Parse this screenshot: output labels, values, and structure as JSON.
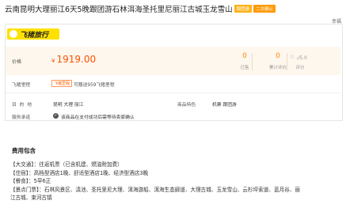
{
  "header": {
    "title": "云南昆明大理丽江6天5晚跟团游石林洱海圣托里尼丽江古城玉龙雪山",
    "badges": [
      "跟团游",
      "二次确认"
    ],
    "seller_nick": "幸福"
  },
  "brand": {
    "logo_text": "飞猪旅行",
    "logo_color": "#ffe100"
  },
  "price": {
    "label": "价格",
    "currency": "¥",
    "value": "1919.00",
    "sold_count": "0",
    "sold_label": "已售",
    "review_count": "0",
    "review_label": "累计评价",
    "rating": "-/5.0",
    "rating_label": "评分"
  },
  "mileage": {
    "label": "飞猪里程",
    "tag": "飞猪里程",
    "text": "可赠送959飞猪里程"
  },
  "info": {
    "destination_label": "目 的 地",
    "destination_value": "昆明  大理  丽江",
    "feature_label": "商品特色",
    "feature_value": "机票  跟团游",
    "service_label": "服务承诺",
    "service_value": "该商品在支付成功后需等待卖家确认"
  },
  "fees": {
    "title": "费用包含",
    "lines": [
      "【大交通】：往返机票（已含机建、燃油附加费）",
      "【住宿】：高档型酒店1晚、舒适型酒店1晚、经济型酒店3晚",
      "【餐食】：5早6正",
      "【景点门票】：石林风景区、滇池、圣托里尼大理、洱海游船、洱海生态廊道、大理古城、玉龙雪山、云杉坪索道、蓝月谷、丽",
      "江古城、束河古镇"
    ]
  },
  "colors": {
    "accent": "#ff5000",
    "stat": "#ff8a00",
    "band": "#fdf7ee"
  }
}
